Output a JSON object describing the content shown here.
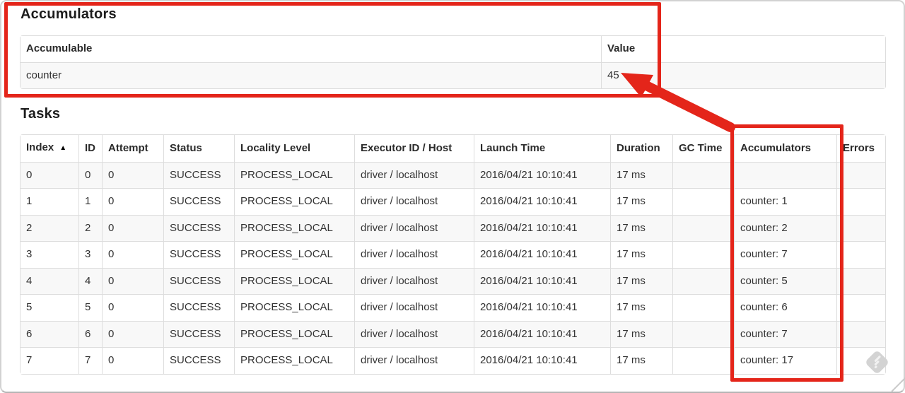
{
  "colors": {
    "annotation_red": "#e4251a",
    "table_border": "#dddddd",
    "row_stripe": "#f8f8f8"
  },
  "accumulators_section": {
    "title": "Accumulators",
    "table": {
      "headers": [
        "Accumulable",
        "Value"
      ],
      "rows": [
        [
          "counter",
          "45"
        ]
      ]
    }
  },
  "tasks_section": {
    "title": "Tasks",
    "table": {
      "headers": [
        {
          "label": "Index",
          "sort_icon": "▲"
        },
        "ID",
        "Attempt",
        "Status",
        "Locality Level",
        "Executor ID / Host",
        "Launch Time",
        "Duration",
        "GC Time",
        "Accumulators",
        "Errors"
      ],
      "rows": [
        [
          "0",
          "0",
          "0",
          "SUCCESS",
          "PROCESS_LOCAL",
          "driver / localhost",
          "2016/04/21 10:10:41",
          "17 ms",
          "",
          "",
          ""
        ],
        [
          "1",
          "1",
          "0",
          "SUCCESS",
          "PROCESS_LOCAL",
          "driver / localhost",
          "2016/04/21 10:10:41",
          "17 ms",
          "",
          "counter: 1",
          ""
        ],
        [
          "2",
          "2",
          "0",
          "SUCCESS",
          "PROCESS_LOCAL",
          "driver / localhost",
          "2016/04/21 10:10:41",
          "17 ms",
          "",
          "counter: 2",
          ""
        ],
        [
          "3",
          "3",
          "0",
          "SUCCESS",
          "PROCESS_LOCAL",
          "driver / localhost",
          "2016/04/21 10:10:41",
          "17 ms",
          "",
          "counter: 7",
          ""
        ],
        [
          "4",
          "4",
          "0",
          "SUCCESS",
          "PROCESS_LOCAL",
          "driver / localhost",
          "2016/04/21 10:10:41",
          "17 ms",
          "",
          "counter: 5",
          ""
        ],
        [
          "5",
          "5",
          "0",
          "SUCCESS",
          "PROCESS_LOCAL",
          "driver / localhost",
          "2016/04/21 10:10:41",
          "17 ms",
          "",
          "counter: 6",
          ""
        ],
        [
          "6",
          "6",
          "0",
          "SUCCESS",
          "PROCESS_LOCAL",
          "driver / localhost",
          "2016/04/21 10:10:41",
          "17 ms",
          "",
          "counter: 7",
          ""
        ],
        [
          "7",
          "7",
          "0",
          "SUCCESS",
          "PROCESS_LOCAL",
          "driver / localhost",
          "2016/04/21 10:10:41",
          "17 ms",
          "",
          "counter: 17",
          ""
        ]
      ]
    }
  },
  "annotations": {
    "box_accumulators_summary": "red box around Accumulators summary table",
    "box_accumulators_column": "red box around Accumulators task column",
    "arrow": "red arrow from Accumulators column to summary value 45"
  }
}
